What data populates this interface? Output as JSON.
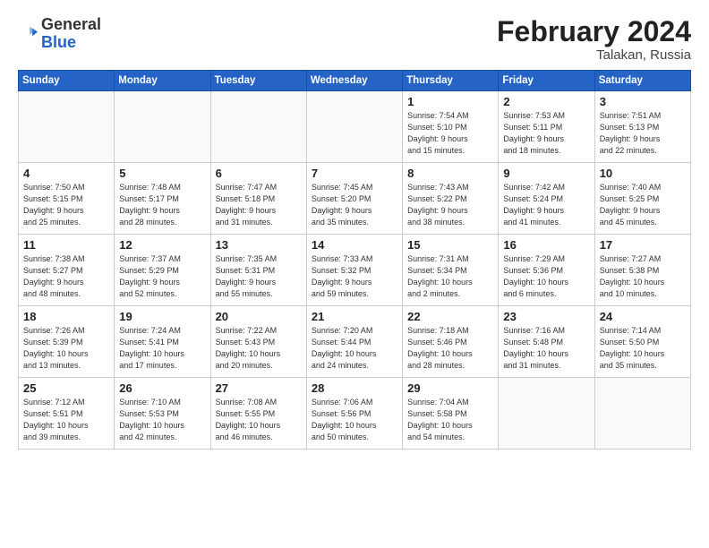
{
  "header": {
    "logo_general": "General",
    "logo_blue": "Blue",
    "title": "February 2024",
    "location": "Talakan, Russia"
  },
  "days_of_week": [
    "Sunday",
    "Monday",
    "Tuesday",
    "Wednesday",
    "Thursday",
    "Friday",
    "Saturday"
  ],
  "weeks": [
    [
      {
        "day": "",
        "detail": ""
      },
      {
        "day": "",
        "detail": ""
      },
      {
        "day": "",
        "detail": ""
      },
      {
        "day": "",
        "detail": ""
      },
      {
        "day": "1",
        "detail": "Sunrise: 7:54 AM\nSunset: 5:10 PM\nDaylight: 9 hours\nand 15 minutes."
      },
      {
        "day": "2",
        "detail": "Sunrise: 7:53 AM\nSunset: 5:11 PM\nDaylight: 9 hours\nand 18 minutes."
      },
      {
        "day": "3",
        "detail": "Sunrise: 7:51 AM\nSunset: 5:13 PM\nDaylight: 9 hours\nand 22 minutes."
      }
    ],
    [
      {
        "day": "4",
        "detail": "Sunrise: 7:50 AM\nSunset: 5:15 PM\nDaylight: 9 hours\nand 25 minutes."
      },
      {
        "day": "5",
        "detail": "Sunrise: 7:48 AM\nSunset: 5:17 PM\nDaylight: 9 hours\nand 28 minutes."
      },
      {
        "day": "6",
        "detail": "Sunrise: 7:47 AM\nSunset: 5:18 PM\nDaylight: 9 hours\nand 31 minutes."
      },
      {
        "day": "7",
        "detail": "Sunrise: 7:45 AM\nSunset: 5:20 PM\nDaylight: 9 hours\nand 35 minutes."
      },
      {
        "day": "8",
        "detail": "Sunrise: 7:43 AM\nSunset: 5:22 PM\nDaylight: 9 hours\nand 38 minutes."
      },
      {
        "day": "9",
        "detail": "Sunrise: 7:42 AM\nSunset: 5:24 PM\nDaylight: 9 hours\nand 41 minutes."
      },
      {
        "day": "10",
        "detail": "Sunrise: 7:40 AM\nSunset: 5:25 PM\nDaylight: 9 hours\nand 45 minutes."
      }
    ],
    [
      {
        "day": "11",
        "detail": "Sunrise: 7:38 AM\nSunset: 5:27 PM\nDaylight: 9 hours\nand 48 minutes."
      },
      {
        "day": "12",
        "detail": "Sunrise: 7:37 AM\nSunset: 5:29 PM\nDaylight: 9 hours\nand 52 minutes."
      },
      {
        "day": "13",
        "detail": "Sunrise: 7:35 AM\nSunset: 5:31 PM\nDaylight: 9 hours\nand 55 minutes."
      },
      {
        "day": "14",
        "detail": "Sunrise: 7:33 AM\nSunset: 5:32 PM\nDaylight: 9 hours\nand 59 minutes."
      },
      {
        "day": "15",
        "detail": "Sunrise: 7:31 AM\nSunset: 5:34 PM\nDaylight: 10 hours\nand 2 minutes."
      },
      {
        "day": "16",
        "detail": "Sunrise: 7:29 AM\nSunset: 5:36 PM\nDaylight: 10 hours\nand 6 minutes."
      },
      {
        "day": "17",
        "detail": "Sunrise: 7:27 AM\nSunset: 5:38 PM\nDaylight: 10 hours\nand 10 minutes."
      }
    ],
    [
      {
        "day": "18",
        "detail": "Sunrise: 7:26 AM\nSunset: 5:39 PM\nDaylight: 10 hours\nand 13 minutes."
      },
      {
        "day": "19",
        "detail": "Sunrise: 7:24 AM\nSunset: 5:41 PM\nDaylight: 10 hours\nand 17 minutes."
      },
      {
        "day": "20",
        "detail": "Sunrise: 7:22 AM\nSunset: 5:43 PM\nDaylight: 10 hours\nand 20 minutes."
      },
      {
        "day": "21",
        "detail": "Sunrise: 7:20 AM\nSunset: 5:44 PM\nDaylight: 10 hours\nand 24 minutes."
      },
      {
        "day": "22",
        "detail": "Sunrise: 7:18 AM\nSunset: 5:46 PM\nDaylight: 10 hours\nand 28 minutes."
      },
      {
        "day": "23",
        "detail": "Sunrise: 7:16 AM\nSunset: 5:48 PM\nDaylight: 10 hours\nand 31 minutes."
      },
      {
        "day": "24",
        "detail": "Sunrise: 7:14 AM\nSunset: 5:50 PM\nDaylight: 10 hours\nand 35 minutes."
      }
    ],
    [
      {
        "day": "25",
        "detail": "Sunrise: 7:12 AM\nSunset: 5:51 PM\nDaylight: 10 hours\nand 39 minutes."
      },
      {
        "day": "26",
        "detail": "Sunrise: 7:10 AM\nSunset: 5:53 PM\nDaylight: 10 hours\nand 42 minutes."
      },
      {
        "day": "27",
        "detail": "Sunrise: 7:08 AM\nSunset: 5:55 PM\nDaylight: 10 hours\nand 46 minutes."
      },
      {
        "day": "28",
        "detail": "Sunrise: 7:06 AM\nSunset: 5:56 PM\nDaylight: 10 hours\nand 50 minutes."
      },
      {
        "day": "29",
        "detail": "Sunrise: 7:04 AM\nSunset: 5:58 PM\nDaylight: 10 hours\nand 54 minutes."
      },
      {
        "day": "",
        "detail": ""
      },
      {
        "day": "",
        "detail": ""
      }
    ]
  ]
}
